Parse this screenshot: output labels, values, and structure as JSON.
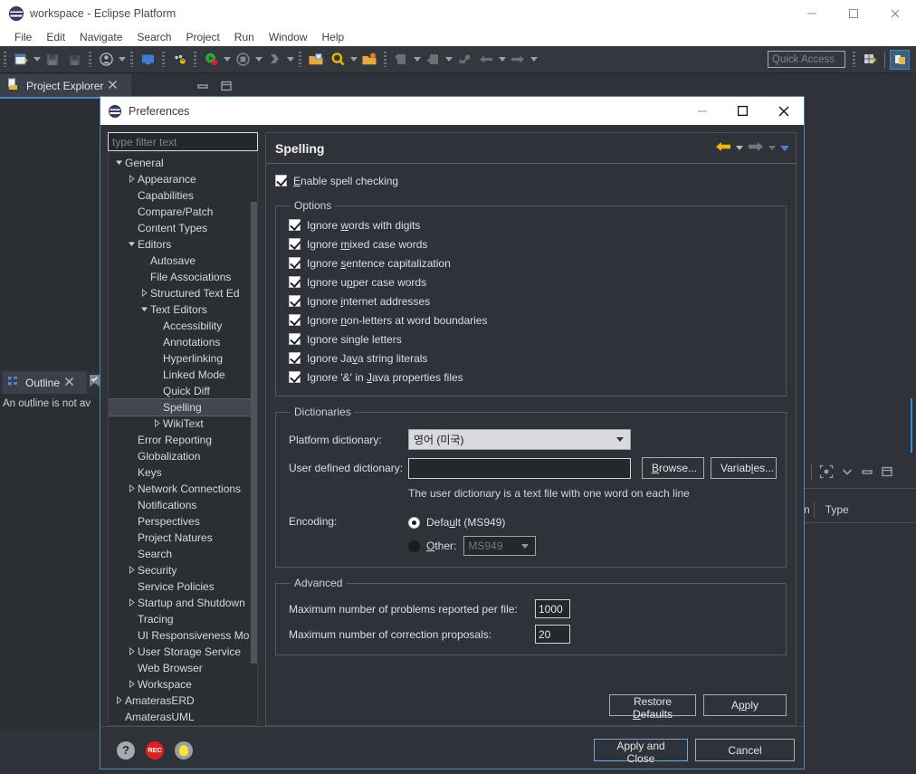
{
  "window": {
    "title": "workspace - Eclipse Platform",
    "icon": "eclipse-logo-icon",
    "controls": {
      "minimize": "minimize-icon",
      "maximize": "maximize-icon",
      "close": "close-icon"
    }
  },
  "menubar": {
    "items": [
      "File",
      "Edit",
      "Navigate",
      "Search",
      "Project",
      "Run",
      "Window",
      "Help"
    ]
  },
  "toolbar": {
    "quick_access_placeholder": "Quick Access",
    "buttons": [
      "new-wizard-icon",
      "save-icon",
      "save-all-icon",
      "user-account-icon",
      "console-icon",
      "debug-dots-icon",
      "run-icon",
      "terminate-icon",
      "step-icon",
      "open-type-icon",
      "search-icon",
      "open-resource-icon",
      "next-annotation-icon",
      "previous-annotation-icon",
      "last-edit-icon",
      "back-icon",
      "forward-icon"
    ],
    "perspective_buttons": [
      "open-perspective-icon",
      "java-perspective-icon"
    ]
  },
  "explorer": {
    "tab_label": "Project Explorer",
    "tab_icon": "project-explorer-icon",
    "close_icon": "close-tab-icon",
    "minimize_icon": "minimize-view-icon",
    "maximize_icon": "maximize-view-icon"
  },
  "outline": {
    "tab_label": "Outline",
    "tab_icon": "outline-icon",
    "close_icon": "close-tab-icon",
    "message": "An outline is not av"
  },
  "right_view": {
    "columns": [
      "n",
      "Type"
    ],
    "toolbar_icons": [
      "focus-icon",
      "view-menu-icon",
      "minimize-view-icon",
      "maximize-view-icon"
    ]
  },
  "dialog": {
    "title": "Preferences",
    "icon": "eclipse-logo-icon",
    "controls": {
      "minimize": "minimize-icon",
      "maximize": "maximize-icon",
      "close": "close-icon"
    },
    "filter_placeholder": "type filter text",
    "tree": [
      {
        "label": "General",
        "indent": 0,
        "arrow": "expanded",
        "selected": false
      },
      {
        "label": "Appearance",
        "indent": 1,
        "arrow": "collapsed",
        "selected": false
      },
      {
        "label": "Capabilities",
        "indent": 1,
        "arrow": "none",
        "selected": false
      },
      {
        "label": "Compare/Patch",
        "indent": 1,
        "arrow": "none",
        "selected": false
      },
      {
        "label": "Content Types",
        "indent": 1,
        "arrow": "none",
        "selected": false
      },
      {
        "label": "Editors",
        "indent": 1,
        "arrow": "expanded",
        "selected": false
      },
      {
        "label": "Autosave",
        "indent": 2,
        "arrow": "none",
        "selected": false
      },
      {
        "label": "File Associations",
        "indent": 2,
        "arrow": "none",
        "selected": false
      },
      {
        "label": "Structured Text Ed",
        "indent": 2,
        "arrow": "collapsed",
        "selected": false
      },
      {
        "label": "Text Editors",
        "indent": 2,
        "arrow": "expanded",
        "selected": false
      },
      {
        "label": "Accessibility",
        "indent": 3,
        "arrow": "none",
        "selected": false
      },
      {
        "label": "Annotations",
        "indent": 3,
        "arrow": "none",
        "selected": false
      },
      {
        "label": "Hyperlinking",
        "indent": 3,
        "arrow": "none",
        "selected": false
      },
      {
        "label": "Linked Mode",
        "indent": 3,
        "arrow": "none",
        "selected": false
      },
      {
        "label": "Quick Diff",
        "indent": 3,
        "arrow": "none",
        "selected": false
      },
      {
        "label": "Spelling",
        "indent": 3,
        "arrow": "none",
        "selected": true
      },
      {
        "label": "WikiText",
        "indent": 3,
        "arrow": "collapsed",
        "selected": false
      },
      {
        "label": "Error Reporting",
        "indent": 1,
        "arrow": "none",
        "selected": false
      },
      {
        "label": "Globalization",
        "indent": 1,
        "arrow": "none",
        "selected": false
      },
      {
        "label": "Keys",
        "indent": 1,
        "arrow": "none",
        "selected": false
      },
      {
        "label": "Network Connections",
        "indent": 1,
        "arrow": "collapsed",
        "selected": false
      },
      {
        "label": "Notifications",
        "indent": 1,
        "arrow": "none",
        "selected": false
      },
      {
        "label": "Perspectives",
        "indent": 1,
        "arrow": "none",
        "selected": false
      },
      {
        "label": "Project Natures",
        "indent": 1,
        "arrow": "none",
        "selected": false
      },
      {
        "label": "Search",
        "indent": 1,
        "arrow": "none",
        "selected": false
      },
      {
        "label": "Security",
        "indent": 1,
        "arrow": "collapsed",
        "selected": false
      },
      {
        "label": "Service Policies",
        "indent": 1,
        "arrow": "none",
        "selected": false
      },
      {
        "label": "Startup and Shutdown",
        "indent": 1,
        "arrow": "collapsed",
        "selected": false
      },
      {
        "label": "Tracing",
        "indent": 1,
        "arrow": "none",
        "selected": false
      },
      {
        "label": "UI Responsiveness Mo",
        "indent": 1,
        "arrow": "none",
        "selected": false
      },
      {
        "label": "User Storage Service",
        "indent": 1,
        "arrow": "collapsed",
        "selected": false
      },
      {
        "label": "Web Browser",
        "indent": 1,
        "arrow": "none",
        "selected": false
      },
      {
        "label": "Workspace",
        "indent": 1,
        "arrow": "collapsed",
        "selected": false
      },
      {
        "label": "AmaterasERD",
        "indent": 0,
        "arrow": "collapsed",
        "selected": false
      },
      {
        "label": "AmaterasUML",
        "indent": 0,
        "arrow": "none",
        "selected": false
      }
    ],
    "page": {
      "title": "Spelling",
      "nav": {
        "back_icon": "back-arrow-icon",
        "forward_icon": "forward-arrow-icon",
        "menu_icon": "dropdown-arrow-icon"
      },
      "enable_spell_checking": {
        "label": "Enable spell checking",
        "mnemonic": "E",
        "checked": true
      },
      "options_group": {
        "legend": "Options",
        "items": [
          {
            "pre": "Ignore ",
            "mnemonic": "w",
            "post": "ords with digits",
            "checked": true
          },
          {
            "pre": "Ignore ",
            "mnemonic": "m",
            "post": "ixed case words",
            "checked": true
          },
          {
            "pre": "Ignore ",
            "mnemonic": "s",
            "post": "entence capitalization",
            "checked": true
          },
          {
            "pre": "Ignore u",
            "mnemonic": "p",
            "post": "per case words",
            "checked": true
          },
          {
            "pre": "Ignore ",
            "mnemonic": "i",
            "post": "nternet addresses",
            "checked": true
          },
          {
            "pre": "Ignore ",
            "mnemonic": "n",
            "post": "on-letters at word boundaries",
            "checked": true
          },
          {
            "pre": "Ignore single letters",
            "mnemonic": "",
            "post": "",
            "checked": true
          },
          {
            "pre": "Ignore Ja",
            "mnemonic": "v",
            "post": "a string literals",
            "checked": true
          },
          {
            "pre": "Ignore '&' in ",
            "mnemonic": "J",
            "post": "ava properties files",
            "checked": true
          }
        ]
      },
      "dictionaries_group": {
        "legend": "Dictionaries",
        "platform_label": "Platform dictionary:",
        "platform_value": "영어 (미국)",
        "platform_options": [
          "영어 (미국)"
        ],
        "user_label": "User defined dictionary:",
        "user_value": "",
        "browse_button": {
          "pre": "",
          "mnemonic": "B",
          "post": "rowse..."
        },
        "variables_button": {
          "pre": "Variab",
          "mnemonic": "l",
          "post": "es..."
        },
        "hint": "The user dictionary is a text file with one word on each line",
        "encoding_label": "Encoding:",
        "encoding_default": {
          "pre": "Defa",
          "mnemonic": "u",
          "post": "lt (MS949)",
          "selected": true
        },
        "encoding_other": {
          "pre": "",
          "mnemonic": "O",
          "post": "ther:",
          "selected": false
        },
        "other_value": "MS949"
      },
      "advanced_group": {
        "legend": "Advanced",
        "max_problems_label": "Maximum number of problems reported per file:",
        "max_problems_value": "1000",
        "max_proposals_label": "Maximum number of correction proposals:",
        "max_proposals_value": "20"
      },
      "restore_defaults_button": {
        "pre": "Restore ",
        "mnemonic": "D",
        "post": "efaults"
      },
      "apply_button": {
        "pre": "A",
        "mnemonic": "p",
        "post": "ply"
      }
    },
    "footer": {
      "icons": [
        "help-icon",
        "rec-icon",
        "tip-bulb-icon"
      ],
      "rec_label": "REC",
      "apply_and_close_button": "Apply and Close",
      "cancel_button": "Cancel"
    }
  },
  "colors": {
    "accent_blue": "#3d8bcd",
    "dialog_border": "#4a8ab5",
    "panel_bg": "#2f3238",
    "tree_bg": "#2b2e33",
    "selected_row": "#41464f",
    "back_arrow_yellow": "#f2b705",
    "rec_red": "#e02020",
    "bulb_yellow": "#f5e636"
  }
}
